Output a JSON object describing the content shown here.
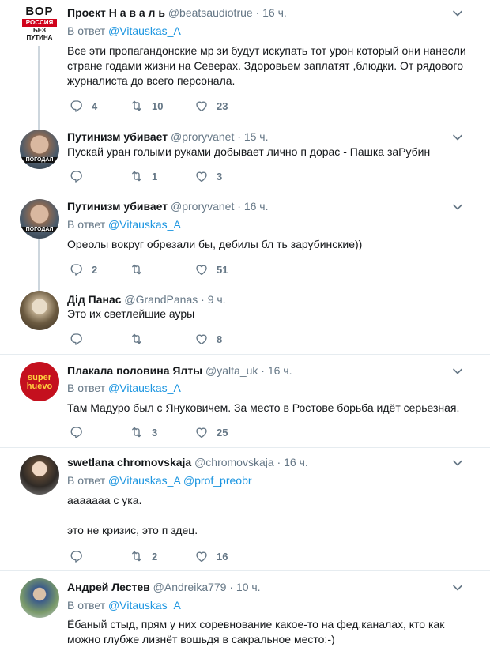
{
  "tweets": [
    {
      "name": "Проект Н а в а л ь",
      "handle": "@beatsaudiotrue",
      "time": "16 ч.",
      "reply_prefix": "В ответ",
      "reply_to": [
        "@Vitauskas_A"
      ],
      "text": "Все эти пропагандонские мр зи будут искупать тот урон который они нанесли стране годами жизни на Северах. Здоровьем заплатят ,блюдки. От рядового журналиста до всего персонала.",
      "replies": "4",
      "retweets": "10",
      "likes": "23",
      "avatar_text": [
        "ВОР",
        "РОССИЯ",
        "БЕЗ",
        "ПУТИНА"
      ]
    },
    {
      "name": "Путинизм убивает",
      "handle": "@proryvanet",
      "time": "15 ч.",
      "text": "Пускай уран голыми руками добывает лично п дорас - Пашка заРубин",
      "replies": "",
      "retweets": "1",
      "likes": "3",
      "avatar_text": [
        "ПОГОДАЛ"
      ]
    },
    {
      "name": "Путинизм убивает",
      "handle": "@proryvanet",
      "time": "16 ч.",
      "reply_prefix": "В ответ",
      "reply_to": [
        "@Vitauskas_A"
      ],
      "text": "Ореолы вокруг обрезали бы, дебилы бл ть зарубинские))",
      "replies": "2",
      "retweets": "",
      "likes": "51",
      "avatar_text": [
        "ПОГОДАЛ"
      ]
    },
    {
      "name": "Дід Панас",
      "handle": "@GrandPanas",
      "time": "9 ч.",
      "text": "Это их светлейшие ауры",
      "replies": "",
      "retweets": "",
      "likes": "8"
    },
    {
      "name": "Плакала половина Ялты",
      "handle": "@yalta_uk",
      "time": "16 ч.",
      "reply_prefix": "В ответ",
      "reply_to": [
        "@Vitauskas_A"
      ],
      "text": "Там Мадуро был с Януковичем. За место в Ростове борьба идёт серьезная.",
      "replies": "",
      "retweets": "3",
      "likes": "25",
      "avatar_text": [
        "super",
        "huevo"
      ]
    },
    {
      "name": "swetlana chromovskaja",
      "handle": "@chromovskaja",
      "time": "16 ч.",
      "reply_prefix": "В ответ",
      "reply_to": [
        "@Vitauskas_A",
        "@prof_preobr"
      ],
      "text_line1": "ааааааа с ука.",
      "text_line2": "это не кризис, это п здец.",
      "replies": "",
      "retweets": "2",
      "likes": "16"
    },
    {
      "name": "Андрей Лестев",
      "handle": "@Andreika779",
      "time": "10 ч.",
      "reply_prefix": "В ответ",
      "reply_to": [
        "@Vitauskas_A"
      ],
      "text": "Ёбаный стыд, прям у них соревнование какое-то на фед.каналах, кто как можно глубже лизнёт вошьдя в сакральное место:-)"
    }
  ],
  "icons": {
    "reply": "reply-icon",
    "retweet": "retweet-icon",
    "like": "heart-icon",
    "caret": "chevron-down-icon"
  },
  "colors": {
    "link": "#1b95e0",
    "muted": "#657786",
    "thread_line": "#cdd6dd",
    "divider": "#e6ecf0"
  }
}
